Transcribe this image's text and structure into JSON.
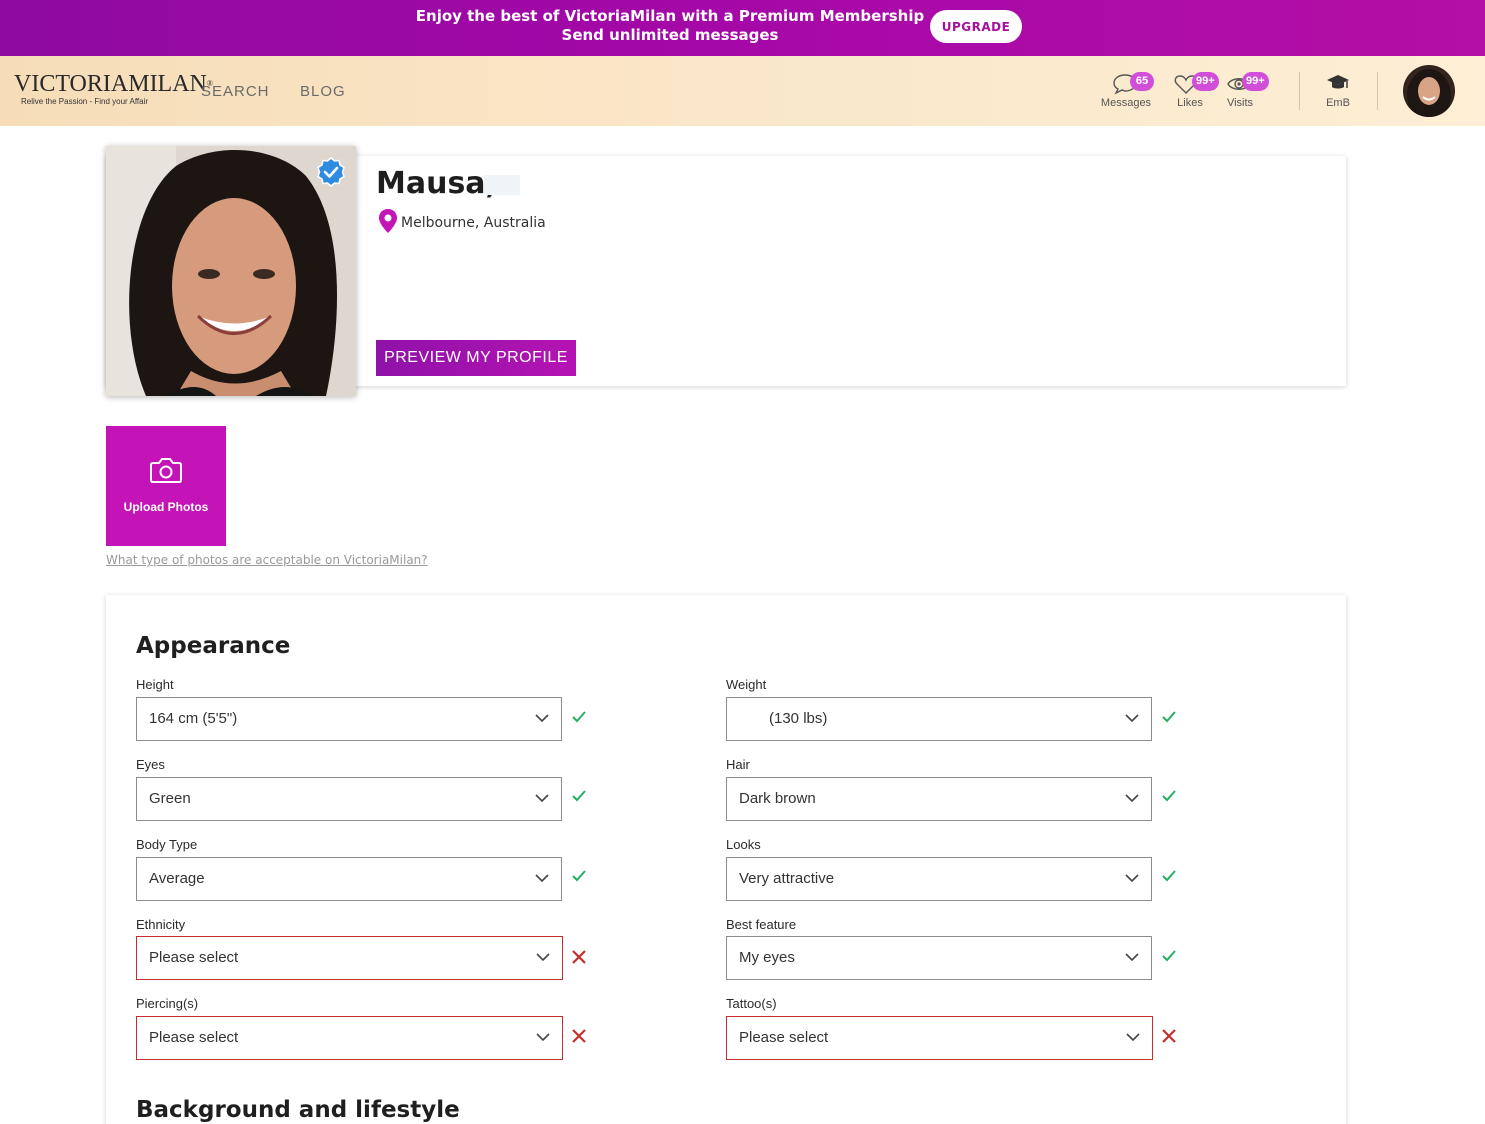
{
  "promo": {
    "line1": "Enjoy the best of VictoriaMilan with a Premium Membership",
    "line2": "Send unlimited messages",
    "upgrade_label": "UPGRADE"
  },
  "header": {
    "logo_text": "VICTORIAMILAN",
    "logo_reg": "®",
    "logo_tagline": "Relive the Passion - Find your Affair",
    "nav": {
      "search": "SEARCH",
      "blog": "BLOG"
    },
    "messages": {
      "label": "Messages",
      "count": "65"
    },
    "likes": {
      "label": "Likes",
      "count": "99+"
    },
    "visits": {
      "label": "Visits",
      "count": "99+"
    },
    "emb": {
      "label": "EmB"
    }
  },
  "profile": {
    "name": "Mausa,",
    "location": "Melbourne, Australia",
    "preview_label": "PREVIEW MY PROFILE"
  },
  "upload": {
    "label": "Upload Photos",
    "help_link": "What type of photos are acceptable on VictoriaMilan?"
  },
  "appearance": {
    "title": "Appearance",
    "fields": {
      "height": {
        "label": "Height",
        "value": "164 cm (5'5\")",
        "status": "valid"
      },
      "weight": {
        "label": "Weight",
        "value": "(130 lbs)",
        "status": "valid"
      },
      "eyes": {
        "label": "Eyes",
        "value": "Green",
        "status": "valid"
      },
      "hair": {
        "label": "Hair",
        "value": "Dark brown",
        "status": "valid"
      },
      "body_type": {
        "label": "Body Type",
        "value": "Average",
        "status": "valid"
      },
      "looks": {
        "label": "Looks",
        "value": "Very attractive",
        "status": "valid"
      },
      "ethnicity": {
        "label": "Ethnicity",
        "value": "Please select",
        "status": "invalid"
      },
      "best_feature": {
        "label": "Best feature",
        "value": "My eyes",
        "status": "valid"
      },
      "piercings": {
        "label": "Piercing(s)",
        "value": "Please select",
        "status": "invalid"
      },
      "tattoos": {
        "label": "Tattoo(s)",
        "value": "Please select",
        "status": "invalid"
      }
    }
  },
  "background": {
    "title": "Background and lifestyle"
  },
  "colors": {
    "brand_purple": "#a608a8",
    "accent_magenta": "#c413b6",
    "valid_green": "#27ae60",
    "invalid_red": "#c62d2d",
    "badge_pink": "#d14fd8"
  }
}
